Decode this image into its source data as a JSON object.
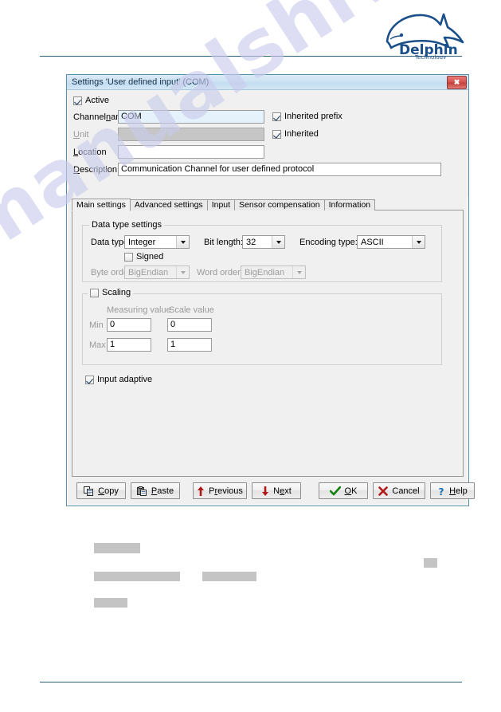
{
  "page": {
    "logo": {
      "name": "Delphin",
      "subtitle": "Technology",
      "brand_color": "#1a4f8a"
    },
    "watermark_text": "manualshive.com"
  },
  "dialog": {
    "title": "Settings 'User defined input' (COM)",
    "close_label": "✖",
    "header": {
      "active": {
        "label": "Active",
        "checked": true
      },
      "fields": [
        {
          "key": "channelname",
          "label": "Channelname",
          "accel": "n",
          "value": "COM",
          "state": "highlight"
        },
        {
          "key": "unit",
          "label": "Unit",
          "accel": "U",
          "value": "",
          "state": "disabled"
        },
        {
          "key": "location",
          "label": "Location",
          "accel": "L",
          "value": "",
          "state": "normal"
        },
        {
          "key": "description",
          "label": "Description",
          "accel": "D",
          "value": "Communication Channel for user defined protocol",
          "state": "normal"
        }
      ],
      "inherited_prefix": {
        "label": "Inherited prefix",
        "checked": true
      },
      "inherited": {
        "label": "Inherited",
        "checked": true
      }
    },
    "tabs": [
      {
        "label": "Main settings",
        "active": true
      },
      {
        "label": "Advanced settings",
        "active": false
      },
      {
        "label": "Input",
        "active": false
      },
      {
        "label": "Sensor compensation",
        "active": false
      },
      {
        "label": "Information",
        "active": false
      }
    ],
    "data_type_group": {
      "title": "Data type settings",
      "data_type_label": "Data type:",
      "data_type_value": "Integer",
      "bit_length_label": "Bit length:",
      "bit_length_value": "32",
      "encoding_type_label": "Encoding type:",
      "encoding_type_value": "ASCII",
      "signed": {
        "label": "Signed",
        "checked": false
      },
      "byte_order_label": "Byte order:",
      "byte_order_value": "BigEndian",
      "word_order_label": "Word order:",
      "word_order_value": "BigEndian"
    },
    "scaling_group": {
      "title": "Scaling",
      "enabled": false,
      "col_measuring": "Measuring value",
      "col_scale": "Scale value",
      "row_min_label": "Min",
      "row_max_label": "Max",
      "min_measuring": "0",
      "min_scale": "0",
      "max_measuring": "1",
      "max_scale": "1"
    },
    "input_adaptive": {
      "label": "Input adaptive",
      "checked": true
    },
    "buttons": [
      {
        "key": "copy",
        "label": "Copy",
        "accel": "C",
        "icon": "copy-icon"
      },
      {
        "key": "paste",
        "label": "Paste",
        "accel": "P",
        "icon": "paste-icon"
      },
      {
        "key": "previous",
        "label": "Previous",
        "accel": "r",
        "icon": "arrow-up-icon"
      },
      {
        "key": "next",
        "label": "Next",
        "accel": "e",
        "icon": "arrow-down-icon"
      },
      {
        "key": "ok",
        "label": "OK",
        "accel": "O",
        "icon": "check-icon"
      },
      {
        "key": "cancel",
        "label": "Cancel",
        "accel": "",
        "icon": "cross-icon"
      },
      {
        "key": "help",
        "label": "Help",
        "accel": "H",
        "icon": "question-icon"
      }
    ]
  }
}
